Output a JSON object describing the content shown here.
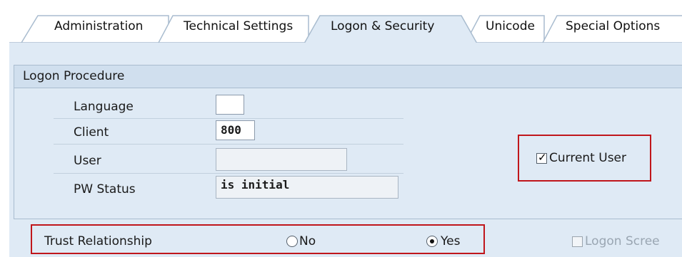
{
  "tabs": [
    {
      "label": "Administration",
      "active": false
    },
    {
      "label": "Technical Settings",
      "active": false
    },
    {
      "label": "Logon & Security",
      "active": true
    },
    {
      "label": "Unicode",
      "active": false
    },
    {
      "label": "Special Options",
      "active": false
    }
  ],
  "logon_procedure": {
    "title": "Logon Procedure",
    "fields": [
      {
        "label": "Language",
        "value": ""
      },
      {
        "label": "Client",
        "value": "800"
      },
      {
        "label": "User",
        "value": ""
      },
      {
        "label": "PW Status",
        "value": "is initial"
      }
    ],
    "current_user": {
      "label": "Current User",
      "checked": true
    }
  },
  "trust": {
    "label": "Trust Relationship",
    "options": [
      {
        "label": "No",
        "selected": false
      },
      {
        "label": "Yes",
        "selected": true
      }
    ],
    "logon_screen": {
      "label": "Logon Scree",
      "checked": false,
      "enabled": false
    }
  },
  "colors": {
    "highlight": "#c0161b",
    "panel": "#dfeaf5",
    "tab_active": "#dfeaf5"
  }
}
